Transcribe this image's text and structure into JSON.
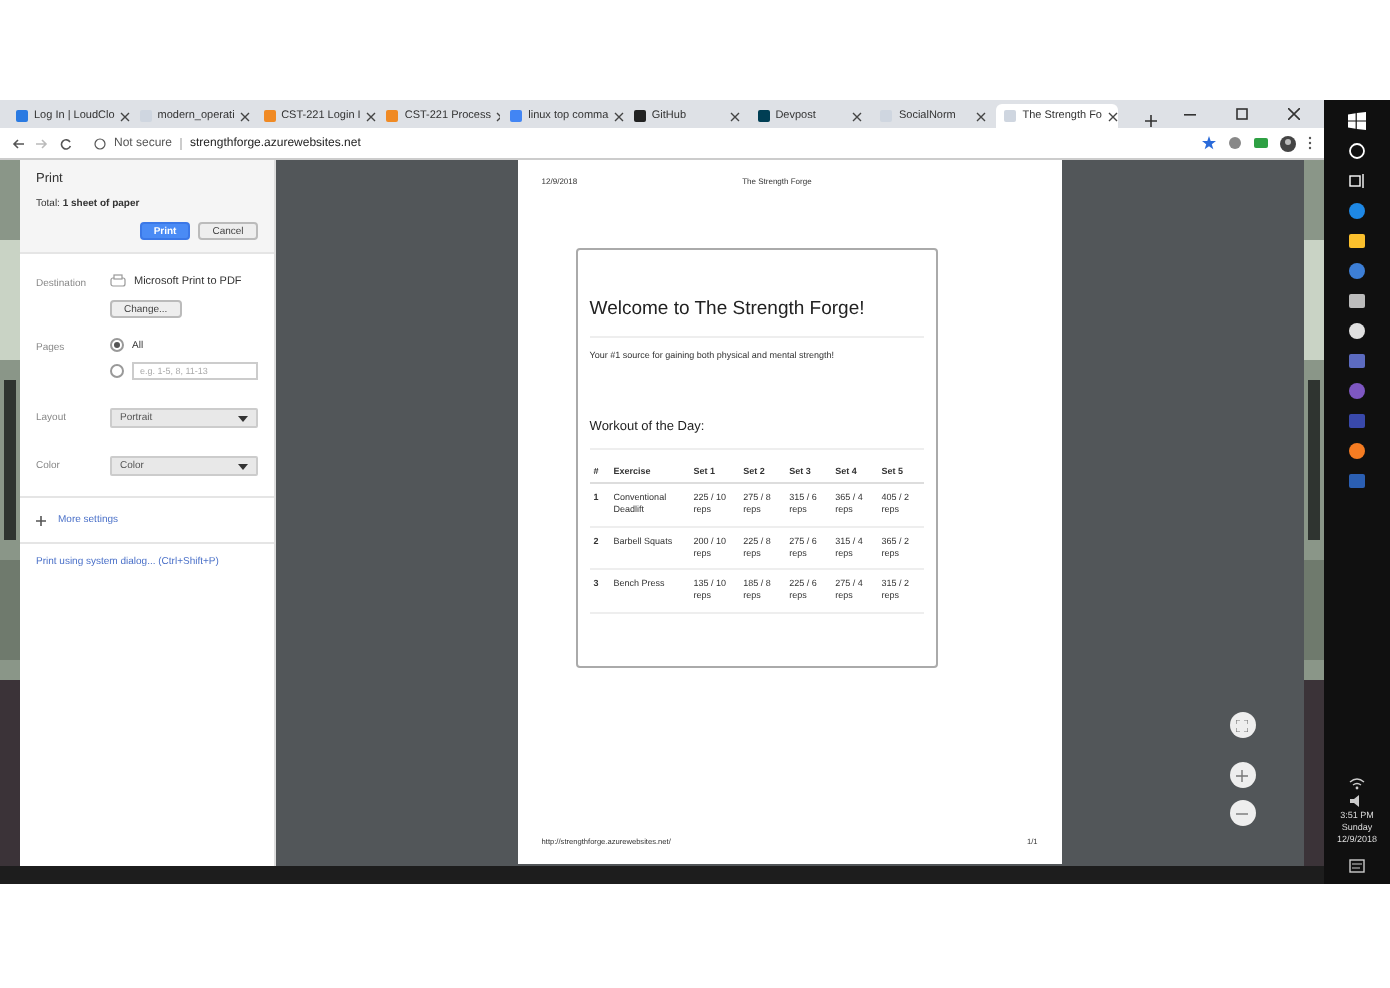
{
  "browser": {
    "tabs": [
      {
        "label": "Log In | LoudClo",
        "selected": false,
        "kind": "site"
      },
      {
        "label": "modern_operati",
        "selected": false,
        "kind": "doc"
      },
      {
        "label": "CST-221 Login I",
        "selected": false,
        "kind": "warn"
      },
      {
        "label": "CST-221 Process",
        "selected": false,
        "kind": "warn"
      },
      {
        "label": "linux top comma",
        "selected": false,
        "kind": "search"
      },
      {
        "label": "GitHub",
        "selected": false,
        "kind": "github"
      },
      {
        "label": "Devpost",
        "selected": false,
        "kind": "devpost"
      },
      {
        "label": "SocialNorm",
        "selected": false,
        "kind": "doc"
      },
      {
        "label": "The Strength Fo",
        "selected": true,
        "kind": "doc"
      }
    ],
    "address_bar": {
      "security": "Not secure",
      "url": "strengthforge.azurewebsites.net"
    }
  },
  "print_panel": {
    "title": "Print",
    "total": "Total: **1 sheet of paper**",
    "buttons": [
      {
        "label": "Print",
        "kind": "primary"
      },
      {
        "label": "Cancel",
        "kind": "secondary"
      }
    ],
    "destination": {
      "label": "Destination",
      "value": "Microsoft Print to PDF",
      "button": "Change..."
    },
    "pages": {
      "label": "Pages",
      "options": [
        {
          "kind": "label",
          "label": "All",
          "selected": true
        },
        {
          "kind": "field",
          "placeholder": "e.g. 1-5, 8, 11-13",
          "selected": false
        }
      ]
    },
    "layout": {
      "label": "Layout",
      "value": "Portrait"
    },
    "color": {
      "label": "Color",
      "value": "Color"
    },
    "more_settings": "More settings",
    "system_dialog": "Print using system dialog... (Ctrl+Shift+P)"
  },
  "preview": {
    "header_date": "12/9/2018",
    "header_title": "The Strength Forge",
    "heading": "Welcome to The Strength Forge!",
    "tagline": "Your #1 source for gaining both physical and mental strength!",
    "workout_title": "Workout of the Day:",
    "table": {
      "columns": [
        "#",
        "Exercise",
        "Set 1",
        "Set 2",
        "Set 3",
        "Set 4",
        "Set 5"
      ],
      "rows": [
        [
          "1",
          "Conventional Deadlift",
          "225 / 10 reps",
          "275 / 8 reps",
          "315 / 6 reps",
          "365 / 4 reps",
          "405 / 2 reps"
        ],
        [
          "2",
          "Barbell Squats",
          "200 / 10 reps",
          "225 / 8 reps",
          "275 / 6 reps",
          "315 / 4 reps",
          "365 / 2 reps"
        ],
        [
          "3",
          "Bench Press",
          "135 / 10 reps",
          "185 / 8 reps",
          "225 / 6 reps",
          "275 / 4 reps",
          "315 / 2 reps"
        ]
      ]
    },
    "footer_url": "http://strengthforge.azurewebsites.net/",
    "footer_page": "1/1"
  },
  "taskbar": {
    "clock": {
      "time": "3:51 PM",
      "day": "Sunday",
      "date": "12/9/2018"
    }
  }
}
